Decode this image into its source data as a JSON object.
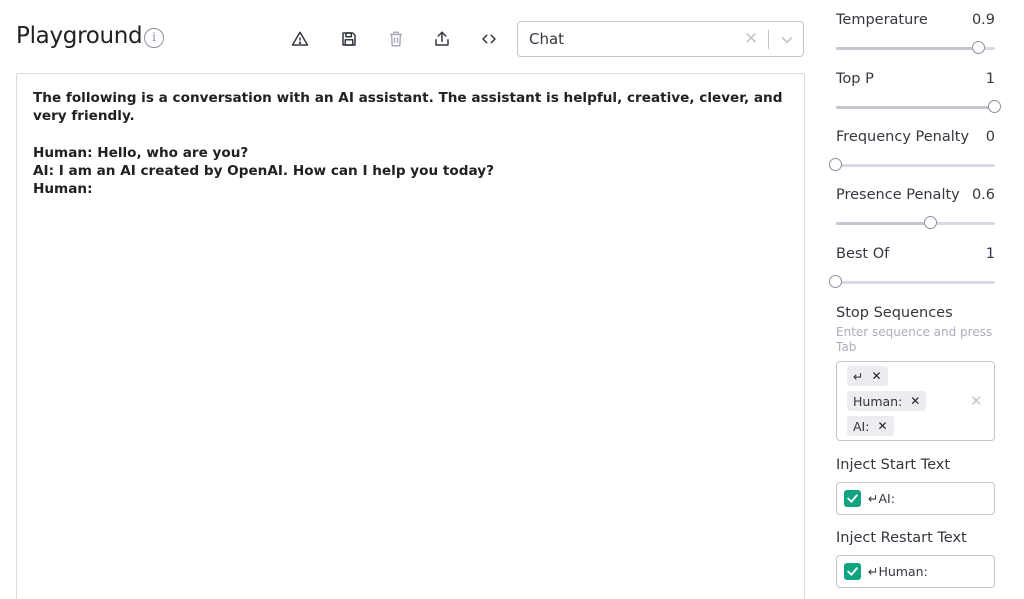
{
  "header": {
    "title": "Playground",
    "preset": {
      "value": "Chat"
    }
  },
  "toolbar": {
    "icons": [
      "warning-icon",
      "save-icon",
      "trash-icon",
      "share-icon",
      "code-icon"
    ]
  },
  "editor": {
    "text": "The following is a conversation with an AI assistant. The assistant is helpful, creative, clever, and very friendly.\n\nHuman: Hello, who are you?\nAI: I am an AI created by OpenAI. How can I help you today?\nHuman:"
  },
  "params": {
    "temperature": {
      "label": "Temperature",
      "value": "0.9",
      "fraction": 0.9
    },
    "top_p": {
      "label": "Top P",
      "value": "1",
      "fraction": 1.0
    },
    "frequency_penalty": {
      "label": "Frequency Penalty",
      "value": "0",
      "fraction": 0.0
    },
    "presence_penalty": {
      "label": "Presence Penalty",
      "value": "0.6",
      "fraction": 0.6
    },
    "best_of": {
      "label": "Best Of",
      "value": "1",
      "fraction": 0.0
    }
  },
  "stop_sequences": {
    "label": "Stop Sequences",
    "hint": "Enter sequence and press Tab",
    "chips": [
      "↵",
      "Human:",
      "AI:"
    ]
  },
  "inject_start": {
    "label": "Inject Start Text",
    "checked": true,
    "value": "↵AI:"
  },
  "inject_restart": {
    "label": "Inject Restart Text",
    "checked": true,
    "value": "↵Human:"
  },
  "colors": {
    "accent": "#10a37f",
    "border": "#c5c5d2"
  }
}
